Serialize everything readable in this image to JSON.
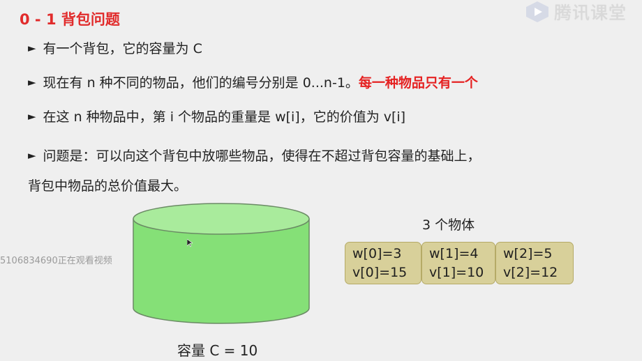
{
  "slide": {
    "title": "0 - 1 背包问题",
    "bullets": [
      {
        "text": "有一个背包，它的容量为 C",
        "highlight": ""
      },
      {
        "text": "现在有 n 种不同的物品，他们的编号分别是 0...n-1。",
        "highlight": "每一种物品只有一个"
      },
      {
        "text": "在这 n 种物品中，第 i 个物品的重量是 w[i]，它的价值为 v[i]",
        "highlight": ""
      },
      {
        "text": "问题是：可以向这个背包中放哪些物品，使得在不超过背包容量的基础上，",
        "continuation": "背包中物品的总价值最大。",
        "highlight": ""
      }
    ],
    "bullet_marker": "►",
    "knapsack": {
      "capacity_label": "容量 C = 10"
    },
    "items_title": "3 个物体",
    "items": [
      {
        "w": "w[0]=3",
        "v": "v[0]=15"
      },
      {
        "w": "w[1]=4",
        "v": "v[1]=10"
      },
      {
        "w": "w[2]=5",
        "v": "v[2]=12"
      }
    ]
  },
  "overlay": {
    "logo_text": "腾讯课堂",
    "watermark": "5106834690正在观看视频"
  },
  "colors": {
    "title": "#e12b2b",
    "highlight": "#e52222",
    "cylinder_fill": "#85e077",
    "cylinder_top": "#a9eb9c",
    "item_fill": "#d8d09a",
    "background": "#efefef"
  }
}
